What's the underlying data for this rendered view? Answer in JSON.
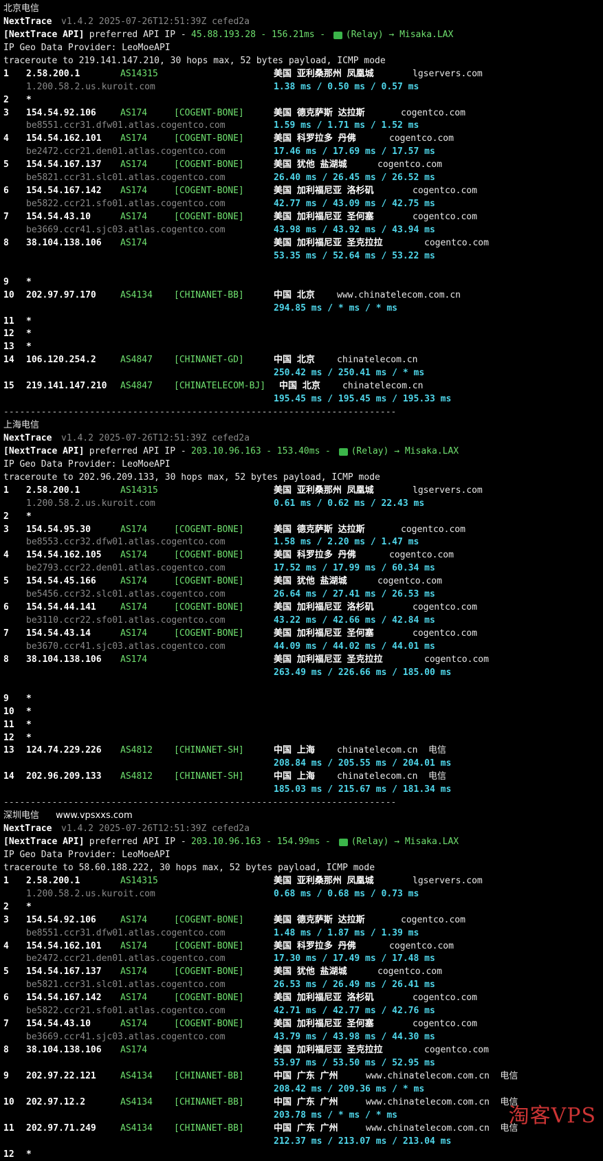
{
  "sections": [
    {
      "title": "北京电信",
      "site": "",
      "header": {
        "app": "NextTrace",
        "version": "v1.4.2 2025-07-26T12:51:39Z cefed2a",
        "api_prefix": "[NextTrace API]",
        "api_text": "preferred API IP -",
        "api_ip": "45.88.193.28",
        "api_dash": "-",
        "api_ms": "156.21ms",
        "api_dash2": "-",
        "relay": "(Relay) → Misaka.LAX",
        "geo": "IP Geo Data Provider: LeoMoeAPI",
        "traceroute": "traceroute to 219.141.147.210, 30 hops max, 52 bytes payload, ICMP mode"
      },
      "lines": [
        {
          "num": "1",
          "ip": "2.58.200.1",
          "asn": "AS14315",
          "tag": "",
          "loc": "美国 亚利桑那州 凤凰城",
          "host": "lgservers.com"
        },
        {
          "sub": "1.200.58.2.us.kuroit.com",
          "rtt": "1.38 ms / 0.50 ms / 0.57 ms"
        },
        {
          "num": "2",
          "star": "*"
        },
        {
          "num": "3",
          "ip": "154.54.92.106",
          "asn": "AS174",
          "tag": "[COGENT-BONE]",
          "loc": "美国 德克萨斯 达拉斯",
          "host": "cogentco.com"
        },
        {
          "sub": "be8551.ccr31.dfw01.atlas.cogentco.com",
          "rtt": "1.59 ms / 1.71 ms / 1.52 ms"
        },
        {
          "num": "4",
          "ip": "154.54.162.101",
          "asn": "AS174",
          "tag": "[COGENT-BONE]",
          "loc": "美国 科罗拉多 丹佛",
          "host": "cogentco.com"
        },
        {
          "sub": "be2472.ccr21.den01.atlas.cogentco.com",
          "rtt": "17.46 ms / 17.69 ms / 17.57 ms"
        },
        {
          "num": "5",
          "ip": "154.54.167.137",
          "asn": "AS174",
          "tag": "[COGENT-BONE]",
          "loc": "美国 犹他 盐湖城",
          "host": "cogentco.com"
        },
        {
          "sub": "be5821.ccr31.slc01.atlas.cogentco.com",
          "rtt": "26.40 ms / 26.45 ms / 26.52 ms"
        },
        {
          "num": "6",
          "ip": "154.54.167.142",
          "asn": "AS174",
          "tag": "[COGENT-BONE]",
          "loc": "美国 加利福尼亚 洛杉矶",
          "host": "cogentco.com"
        },
        {
          "sub": "be5822.ccr21.sfo01.atlas.cogentco.com",
          "rtt": "42.77 ms / 43.09 ms / 42.75 ms"
        },
        {
          "num": "7",
          "ip": "154.54.43.10",
          "asn": "AS174",
          "tag": "[COGENT-BONE]",
          "loc": "美国 加利福尼亚 圣何塞",
          "host": "cogentco.com"
        },
        {
          "sub": "be3669.ccr41.sjc03.atlas.cogentco.com",
          "rtt": "43.98 ms / 43.92 ms / 43.94 ms"
        },
        {
          "num": "8",
          "ip": "38.104.138.106",
          "asn": "AS174",
          "tag": "",
          "loc": "美国 加利福尼亚 圣克拉拉",
          "host": "cogentco.com"
        },
        {
          "sub": "",
          "rtt": "53.35 ms / 52.64 ms / 53.22 ms"
        },
        {
          "blank": true
        },
        {
          "num": "9",
          "star": "*"
        },
        {
          "num": "10",
          "ip": "202.97.97.170",
          "asn": "AS4134",
          "tag": "[CHINANET-BB]",
          "loc": "中国 北京",
          "host": "www.chinatelecom.com.cn"
        },
        {
          "sub": "",
          "rtt": "294.85 ms / * ms / * ms"
        },
        {
          "num": "11",
          "star": "*"
        },
        {
          "num": "12",
          "star": "*"
        },
        {
          "num": "13",
          "star": "*"
        },
        {
          "num": "14",
          "ip": "106.120.254.2",
          "asn": "AS4847",
          "tag": "[CHINANET-GD]",
          "loc": "中国 北京",
          "host": "chinatelecom.cn"
        },
        {
          "sub": "",
          "rtt": "250.42 ms / 250.41 ms / * ms"
        },
        {
          "num": "15",
          "ip": "219.141.147.210",
          "asn": "AS4847",
          "tag": "[CHINATELECOM-BJ]",
          "loc": "中国 北京",
          "host": "chinatelecom.cn",
          "shift": true
        },
        {
          "sub": "",
          "rtt": "195.45 ms / 195.45 ms / 195.33 ms"
        },
        {
          "sep": "-------------------------------------------------------------------------"
        }
      ]
    },
    {
      "title": "上海电信",
      "site": "",
      "header": {
        "app": "NextTrace",
        "version": "v1.4.2 2025-07-26T12:51:39Z cefed2a",
        "api_prefix": "[NextTrace API]",
        "api_text": "preferred API IP -",
        "api_ip": "203.10.96.163",
        "api_dash": "-",
        "api_ms": "153.40ms",
        "api_dash2": "-",
        "relay": "(Relay) → Misaka.LAX",
        "geo": "IP Geo Data Provider: LeoMoeAPI",
        "traceroute": "traceroute to 202.96.209.133, 30 hops max, 52 bytes payload, ICMP mode"
      },
      "lines": [
        {
          "num": "1",
          "ip": "2.58.200.1",
          "asn": "AS14315",
          "tag": "",
          "loc": "美国 亚利桑那州 凤凰城",
          "host": "lgservers.com"
        },
        {
          "sub": "1.200.58.2.us.kuroit.com",
          "rtt": "0.61 ms / 0.62 ms / 22.43 ms"
        },
        {
          "num": "2",
          "star": "*"
        },
        {
          "num": "3",
          "ip": "154.54.95.30",
          "asn": "AS174",
          "tag": "[COGENT-BONE]",
          "loc": "美国 德克萨斯 达拉斯",
          "host": "cogentco.com"
        },
        {
          "sub": "be8553.ccr32.dfw01.atlas.cogentco.com",
          "rtt": "1.58 ms / 2.20 ms / 1.47 ms"
        },
        {
          "num": "4",
          "ip": "154.54.162.105",
          "asn": "AS174",
          "tag": "[COGENT-BONE]",
          "loc": "美国 科罗拉多 丹佛",
          "host": "cogentco.com"
        },
        {
          "sub": "be2793.ccr22.den01.atlas.cogentco.com",
          "rtt": "17.52 ms / 17.99 ms / 60.34 ms"
        },
        {
          "num": "5",
          "ip": "154.54.45.166",
          "asn": "AS174",
          "tag": "[COGENT-BONE]",
          "loc": "美国 犹他 盐湖城",
          "host": "cogentco.com"
        },
        {
          "sub": "be5456.ccr32.slc01.atlas.cogentco.com",
          "rtt": "26.64 ms / 27.41 ms / 26.53 ms"
        },
        {
          "num": "6",
          "ip": "154.54.44.141",
          "asn": "AS174",
          "tag": "[COGENT-BONE]",
          "loc": "美国 加利福尼亚 洛杉矶",
          "host": "cogentco.com"
        },
        {
          "sub": "be3110.ccr22.sfo01.atlas.cogentco.com",
          "rtt": "43.22 ms / 42.66 ms / 42.84 ms"
        },
        {
          "num": "7",
          "ip": "154.54.43.14",
          "asn": "AS174",
          "tag": "[COGENT-BONE]",
          "loc": "美国 加利福尼亚 圣何塞",
          "host": "cogentco.com"
        },
        {
          "sub": "be3670.ccr41.sjc03.atlas.cogentco.com",
          "rtt": "44.09 ms / 44.02 ms / 44.01 ms"
        },
        {
          "num": "8",
          "ip": "38.104.138.106",
          "asn": "AS174",
          "tag": "",
          "loc": "美国 加利福尼亚 圣克拉拉",
          "host": "cogentco.com"
        },
        {
          "sub": "",
          "rtt": "263.49 ms / 226.66 ms / 185.00 ms"
        },
        {
          "blank": true
        },
        {
          "num": "9",
          "star": "*"
        },
        {
          "num": "10",
          "star": "*"
        },
        {
          "num": "11",
          "star": "*"
        },
        {
          "num": "12",
          "star": "*"
        },
        {
          "num": "13",
          "ip": "124.74.229.226",
          "asn": "AS4812",
          "tag": "[CHINANET-SH]",
          "loc": "中国 上海",
          "host": "chinatelecom.cn",
          "isp": "电信"
        },
        {
          "sub": "",
          "rtt": "208.84 ms / 205.55 ms / 204.01 ms"
        },
        {
          "num": "14",
          "ip": "202.96.209.133",
          "asn": "AS4812",
          "tag": "[CHINANET-SH]",
          "loc": "中国 上海",
          "host": "chinatelecom.cn",
          "isp": "电信"
        },
        {
          "sub": "",
          "rtt": "185.03 ms / 215.67 ms / 181.34 ms"
        },
        {
          "sep": "-------------------------------------------------------------------------"
        }
      ]
    },
    {
      "title": "深圳电信",
      "site": "www.vpsxxs.com",
      "header": {
        "app": "NextTrace",
        "version": "v1.4.2 2025-07-26T12:51:39Z cefed2a",
        "api_prefix": "[NextTrace API]",
        "api_text": "preferred API IP -",
        "api_ip": "203.10.96.163",
        "api_dash": "-",
        "api_ms": "154.99ms",
        "api_dash2": "-",
        "relay": "(Relay) → Misaka.LAX",
        "geo": "IP Geo Data Provider: LeoMoeAPI",
        "traceroute": "traceroute to 58.60.188.222, 30 hops max, 52 bytes payload, ICMP mode"
      },
      "lines": [
        {
          "num": "1",
          "ip": "2.58.200.1",
          "asn": "AS14315",
          "tag": "",
          "loc": "美国 亚利桑那州 凤凰城",
          "host": "lgservers.com"
        },
        {
          "sub": "1.200.58.2.us.kuroit.com",
          "rtt": "0.68 ms / 0.68 ms / 0.73 ms"
        },
        {
          "num": "2",
          "star": "*"
        },
        {
          "num": "3",
          "ip": "154.54.92.106",
          "asn": "AS174",
          "tag": "[COGENT-BONE]",
          "loc": "美国 德克萨斯 达拉斯",
          "host": "cogentco.com"
        },
        {
          "sub": "be8551.ccr31.dfw01.atlas.cogentco.com",
          "rtt": "1.48 ms / 1.87 ms / 1.39 ms"
        },
        {
          "num": "4",
          "ip": "154.54.162.101",
          "asn": "AS174",
          "tag": "[COGENT-BONE]",
          "loc": "美国 科罗拉多 丹佛",
          "host": "cogentco.com"
        },
        {
          "sub": "be2472.ccr21.den01.atlas.cogentco.com",
          "rtt": "17.30 ms / 17.49 ms / 17.48 ms"
        },
        {
          "num": "5",
          "ip": "154.54.167.137",
          "asn": "AS174",
          "tag": "[COGENT-BONE]",
          "loc": "美国 犹他 盐湖城",
          "host": "cogentco.com"
        },
        {
          "sub": "be5821.ccr31.slc01.atlas.cogentco.com",
          "rtt": "26.53 ms / 26.49 ms / 26.41 ms"
        },
        {
          "num": "6",
          "ip": "154.54.167.142",
          "asn": "AS174",
          "tag": "[COGENT-BONE]",
          "loc": "美国 加利福尼亚 洛杉矶",
          "host": "cogentco.com"
        },
        {
          "sub": "be5822.ccr21.sfo01.atlas.cogentco.com",
          "rtt": "42.71 ms / 42.77 ms / 42.76 ms"
        },
        {
          "num": "7",
          "ip": "154.54.43.10",
          "asn": "AS174",
          "tag": "[COGENT-BONE]",
          "loc": "美国 加利福尼亚 圣何塞",
          "host": "cogentco.com"
        },
        {
          "sub": "be3669.ccr41.sjc03.atlas.cogentco.com",
          "rtt": "43.79 ms / 43.98 ms / 44.30 ms"
        },
        {
          "num": "8",
          "ip": "38.104.138.106",
          "asn": "AS174",
          "tag": "",
          "loc": "美国 加利福尼亚 圣克拉拉",
          "host": "cogentco.com"
        },
        {
          "sub": "",
          "rtt": "53.97 ms / 53.50 ms / 52.95 ms"
        },
        {
          "num": "9",
          "ip": "202.97.22.121",
          "asn": "AS4134",
          "tag": "[CHINANET-BB]",
          "loc": "中国 广东 广州",
          "host": "www.chinatelecom.com.cn",
          "isp": "电信"
        },
        {
          "sub": "",
          "rtt": "208.42 ms / 209.36 ms / * ms"
        },
        {
          "num": "10",
          "ip": "202.97.12.2",
          "asn": "AS4134",
          "tag": "[CHINANET-BB]",
          "loc": "中国 广东 广州",
          "host": "www.chinatelecom.com.cn",
          "isp": "电信"
        },
        {
          "sub": "",
          "rtt": "203.78 ms / * ms / * ms"
        },
        {
          "num": "11",
          "ip": "202.97.71.249",
          "asn": "AS4134",
          "tag": "[CHINANET-BB]",
          "loc": "中国 广东 广州",
          "host": "www.chinatelecom.com.cn",
          "isp": "电信"
        },
        {
          "sub": "",
          "rtt": "212.37 ms / 213.07 ms / 213.04 ms"
        },
        {
          "num": "12",
          "star": "*"
        }
      ]
    }
  ],
  "watermark": "淘客VPS",
  "colors": {
    "background": "#000000",
    "green": "#6fe06f",
    "cyan": "#4fd6ea",
    "dim": "#8a8a8a",
    "watermark": "#e23a3a"
  }
}
